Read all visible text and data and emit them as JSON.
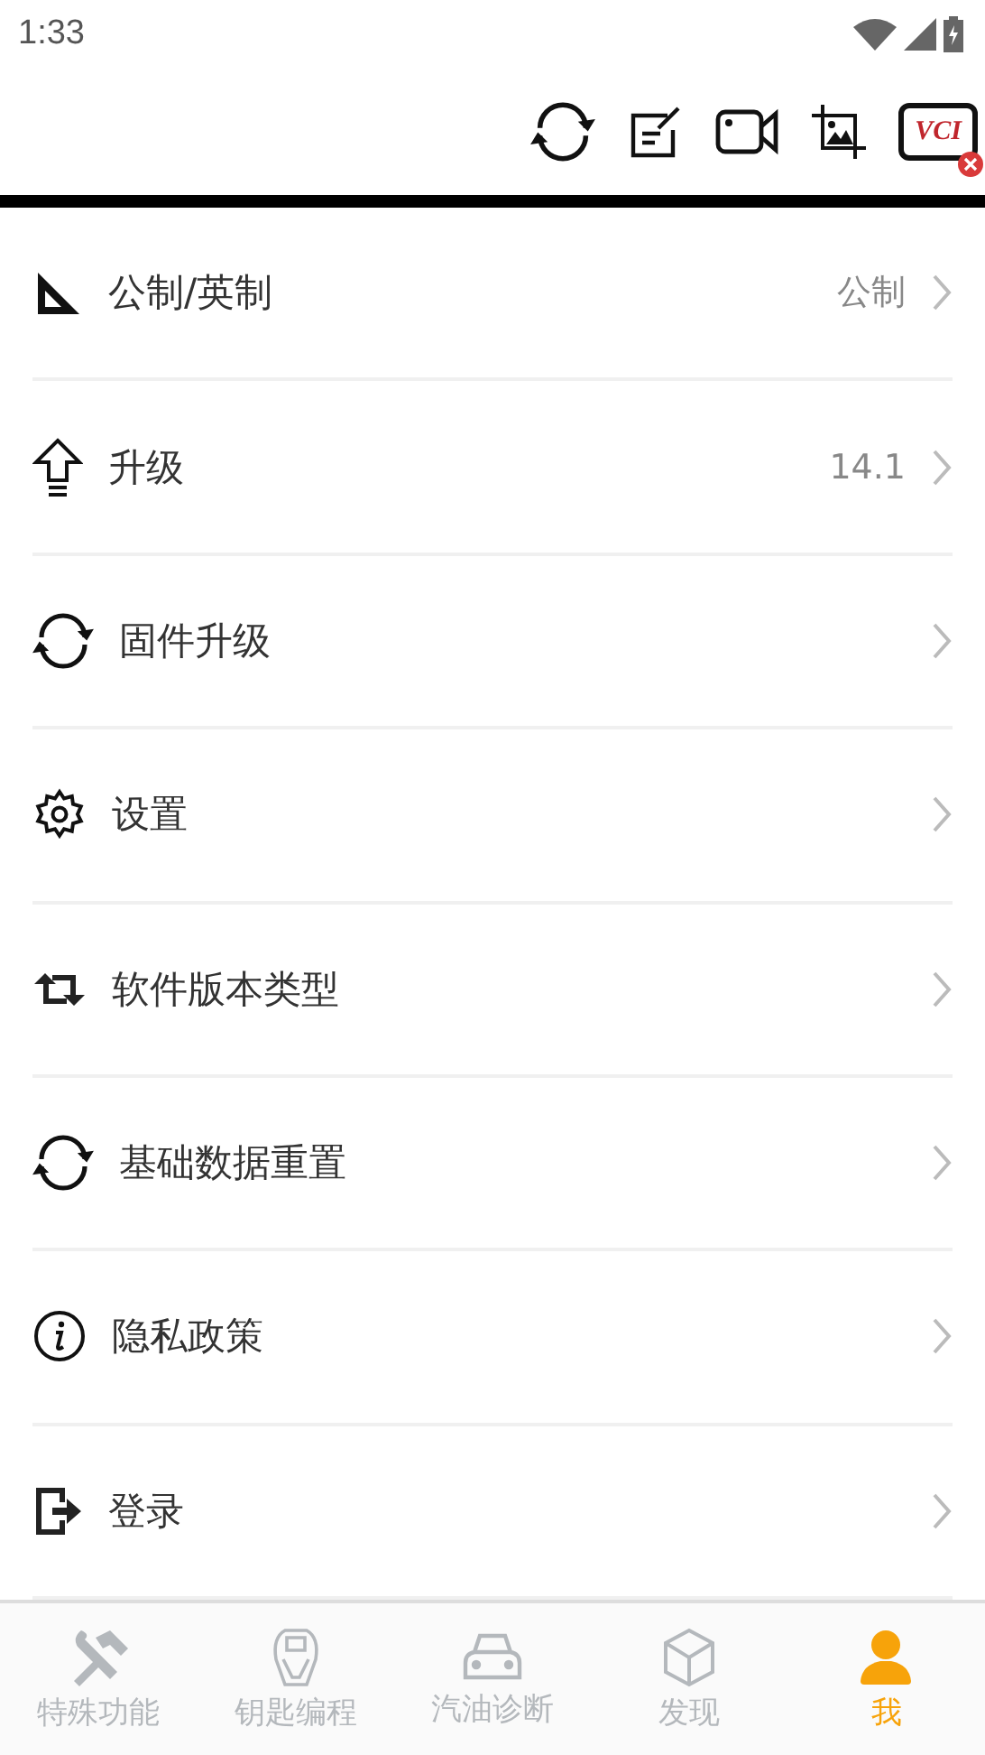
{
  "status_bar": {
    "time": "1:33"
  },
  "toolbar": {
    "vci_label": "VCI",
    "vci_disconnected": true
  },
  "menu": [
    {
      "label": "公制/英制",
      "value": "公制"
    },
    {
      "label": "升级",
      "value": "14.1"
    },
    {
      "label": "固件升级"
    },
    {
      "label": "设置"
    },
    {
      "label": "软件版本类型"
    },
    {
      "label": "基础数据重置"
    },
    {
      "label": "隐私政策"
    },
    {
      "label": "登录"
    }
  ],
  "bottom_nav": [
    {
      "label": "特殊功能",
      "selected": false
    },
    {
      "label": "钥匙编程",
      "selected": false
    },
    {
      "label": "汽油诊断",
      "selected": false
    },
    {
      "label": "发现",
      "selected": false
    },
    {
      "label": "我",
      "selected": true
    }
  ]
}
